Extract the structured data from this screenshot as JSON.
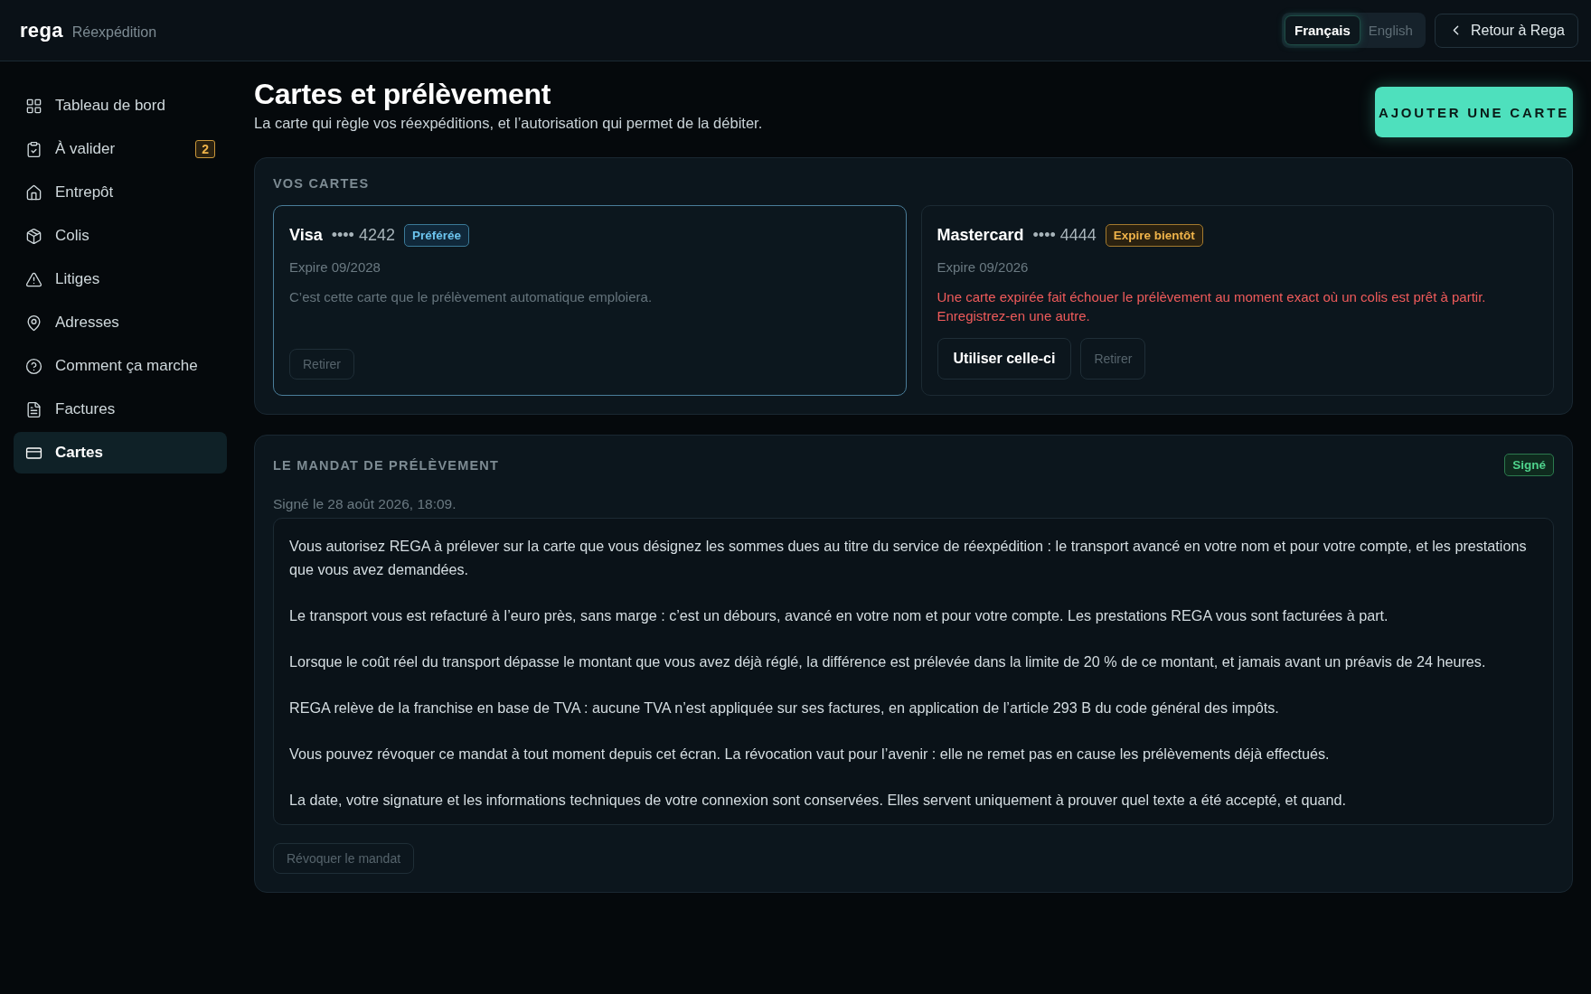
{
  "header": {
    "logo": "rega",
    "product": "Réexpédition",
    "languages": [
      {
        "label": "Français",
        "selected": true
      },
      {
        "label": "English",
        "selected": false
      }
    ],
    "back_link": "Retour à Rega"
  },
  "sidebar": {
    "items": [
      {
        "label": "Tableau de bord",
        "selected": false
      },
      {
        "label": "À valider",
        "selected": false,
        "count": "2"
      },
      {
        "label": "Entrepôt",
        "selected": false
      },
      {
        "label": "Colis",
        "selected": false
      },
      {
        "label": "Litiges",
        "selected": false
      },
      {
        "label": "Adresses",
        "selected": false
      },
      {
        "label": "Comment ça marche",
        "selected": false
      },
      {
        "label": "Factures",
        "selected": false
      },
      {
        "label": "Cartes",
        "selected": true
      }
    ]
  },
  "page": {
    "title": "Cartes et prélèvement",
    "subtitle": "La carte qui règle vos réexpéditions, et l’autorisation qui permet de la débiter.",
    "add_button": "AJOUTER UNE CARTE"
  },
  "cards_section": {
    "heading": "VOS CARTES",
    "cards": [
      {
        "brand": "Visa",
        "dots": "••••",
        "last4": "4242",
        "badge": {
          "kind": "preferred",
          "label": "Préférée"
        },
        "selected": true,
        "expiry": "Expire 09/2028",
        "note": {
          "kind": "info",
          "text": "C’est cette carte que le prélèvement automatique emploiera."
        },
        "actions": [
          {
            "label": "Retirer",
            "disabled": true
          }
        ]
      },
      {
        "brand": "Mastercard",
        "dots": "••••",
        "last4": "4444",
        "badge": {
          "kind": "warning",
          "label": "Expire bientôt"
        },
        "selected": false,
        "expiry": "Expire 09/2026",
        "note": {
          "kind": "error",
          "text": "Une carte expirée fait échouer le prélèvement au moment exact où un colis est prêt à partir. Enregistrez-en une autre."
        },
        "actions": [
          {
            "label": "Utiliser celle-ci",
            "disabled": false
          },
          {
            "label": "Retirer",
            "disabled": true
          }
        ]
      }
    ]
  },
  "mandate": {
    "heading": "LE MANDAT DE PRÉLÈVEMENT",
    "status": "Signé",
    "signed_on": "Signé le 28 août 2026, 18:09.",
    "paragraphs": [
      "Vous autorisez REGA à prélever sur la carte que vous désignez les sommes dues au titre du service de réexpédition : le transport avancé en votre nom et pour votre compte, et les prestations que vous avez demandées.",
      "Le transport vous est refacturé à l’euro près, sans marge : c’est un débours, avancé en votre nom et pour votre compte. Les prestations REGA vous sont facturées à part.",
      "Lorsque le coût réel du transport dépasse le montant que vous avez déjà réglé, la différence est prélevée dans la limite de 20 % de ce montant, et jamais avant un préavis de 24 heures.",
      "REGA relève de la franchise en base de TVA : aucune TVA n’est appliquée sur ses factures, en application de l’article 293 B du code général des impôts.",
      "Vous pouvez révoquer ce mandat à tout moment depuis cet écran. La révocation vaut pour l’avenir : elle ne remet pas en cause les prélèvements déjà effectués.",
      "La date, votre signature et les informations techniques de votre connexion sont conservées. Elles servent uniquement à prouver quel texte a été accepté, et quand."
    ],
    "revoke_button": {
      "label": "Révoquer le mandat",
      "disabled": true
    }
  }
}
